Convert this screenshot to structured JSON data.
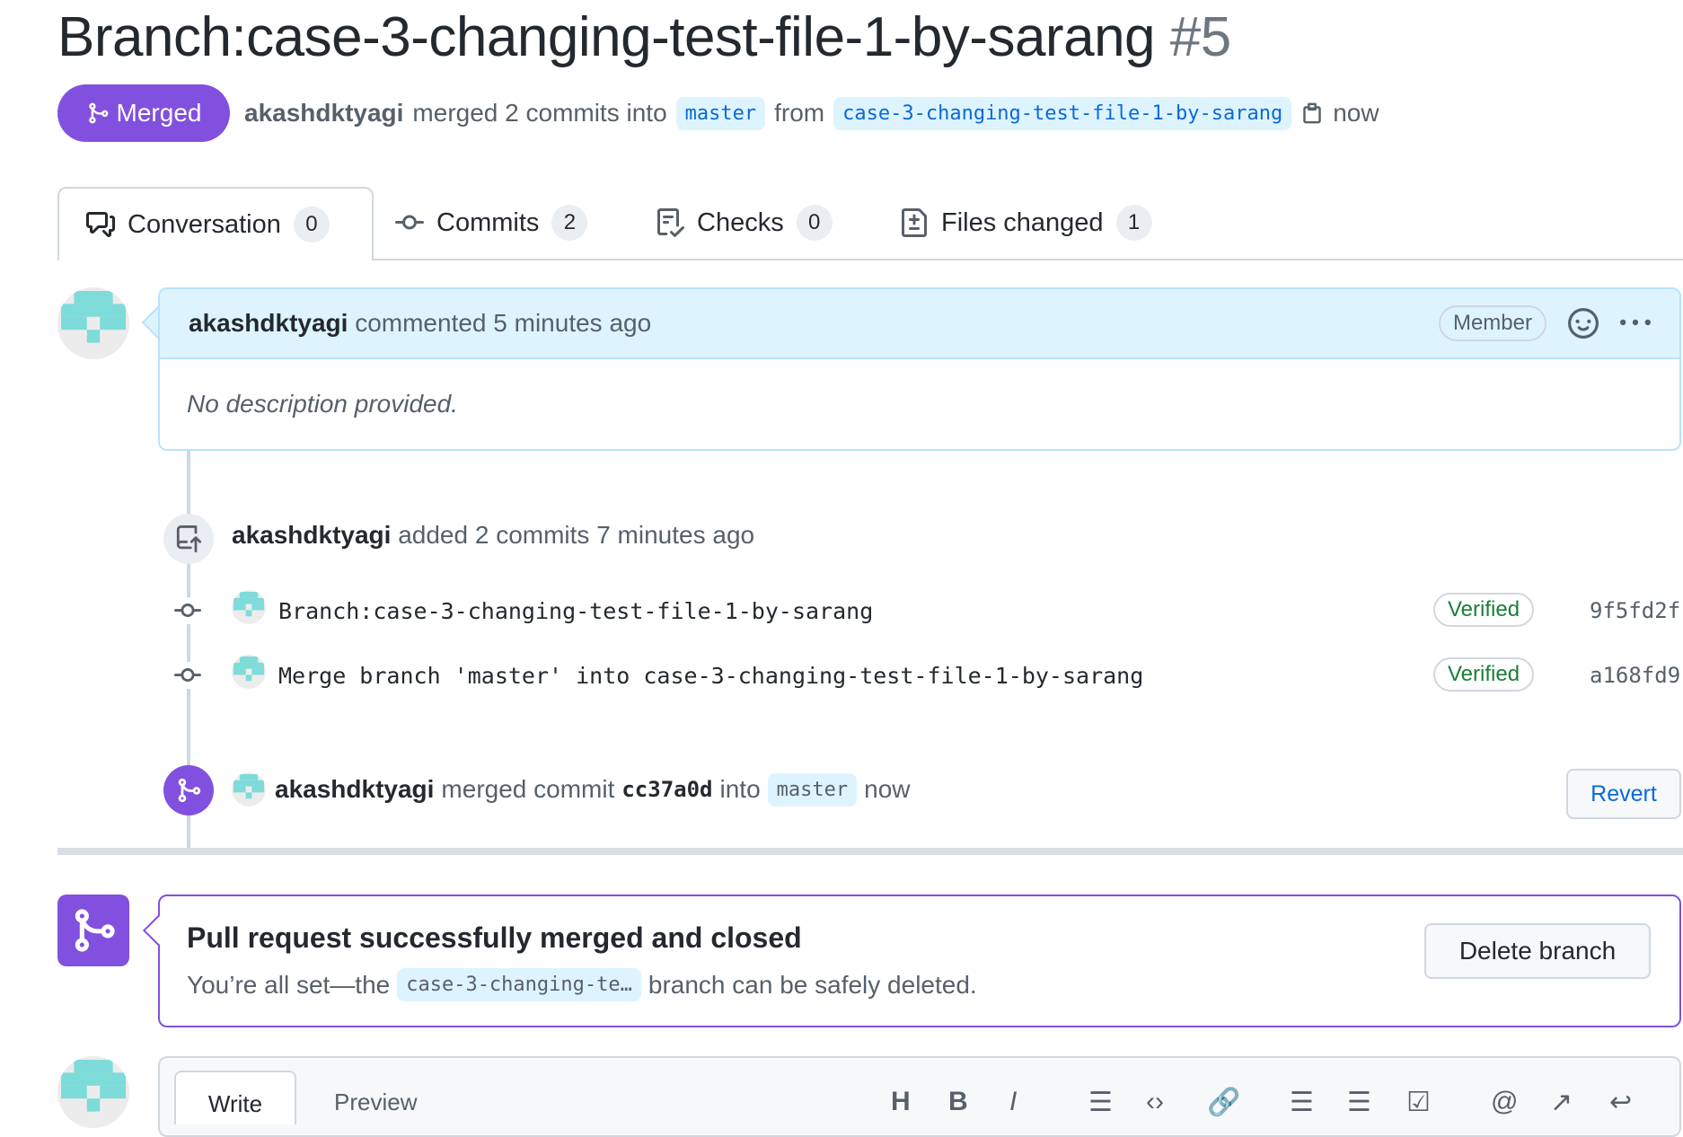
{
  "title": {
    "text": "Branch:case-3-changing-test-file-1-by-sarang",
    "number": "#5"
  },
  "meta": {
    "state_label": "Merged",
    "author": "akashdktyagi",
    "action": "merged 2 commits into",
    "base_branch": "master",
    "from_word": "from",
    "head_branch": "case-3-changing-test-file-1-by-sarang",
    "time": "now"
  },
  "tabs": [
    {
      "label": "Conversation",
      "count": "0",
      "icon": "conversation-icon"
    },
    {
      "label": "Commits",
      "count": "2",
      "icon": "commit-icon"
    },
    {
      "label": "Checks",
      "count": "0",
      "icon": "checklist-icon"
    },
    {
      "label": "Files changed",
      "count": "1",
      "icon": "file-diff-icon"
    }
  ],
  "comment": {
    "author": "akashdktyagi",
    "action": "commented 5 minutes ago",
    "role_badge": "Member",
    "body": "No description provided."
  },
  "commits_event": {
    "author": "akashdktyagi",
    "action": "added 2 commits 7 minutes ago",
    "commits": [
      {
        "message": "Branch:case-3-changing-test-file-1-by-sarang",
        "verified": "Verified",
        "sha": "9f5fd2f"
      },
      {
        "message": "Merge branch 'master' into case-3-changing-test-file-1-by-sarang",
        "verified": "Verified",
        "sha": "a168fd9"
      }
    ]
  },
  "merge_event": {
    "author": "akashdktyagi",
    "action": "merged commit",
    "commit": "cc37a0d",
    "into_word": "into",
    "branch": "master",
    "time": "now",
    "revert_label": "Revert"
  },
  "merged_box": {
    "title": "Pull request successfully merged and closed",
    "sub_prefix": "You’re all set—the",
    "branch": "case-3-changing-te…",
    "sub_suffix": "branch can be safely deleted.",
    "delete_label": "Delete branch"
  },
  "editor": {
    "write_tab": "Write",
    "preview_tab": "Preview",
    "toolbar_icons": [
      "heading-icon",
      "bold-icon",
      "italic-icon",
      "quote-icon",
      "code-icon",
      "link-icon",
      "bullet-list-icon",
      "numbered-list-icon",
      "task-list-icon",
      "mention-icon",
      "reference-icon",
      "reply-icon"
    ]
  },
  "colors": {
    "merged_purple": "#8250df",
    "link_blue": "#0969da",
    "verified_green": "#1a7f37",
    "comment_header_bg": "#ddf4ff"
  }
}
